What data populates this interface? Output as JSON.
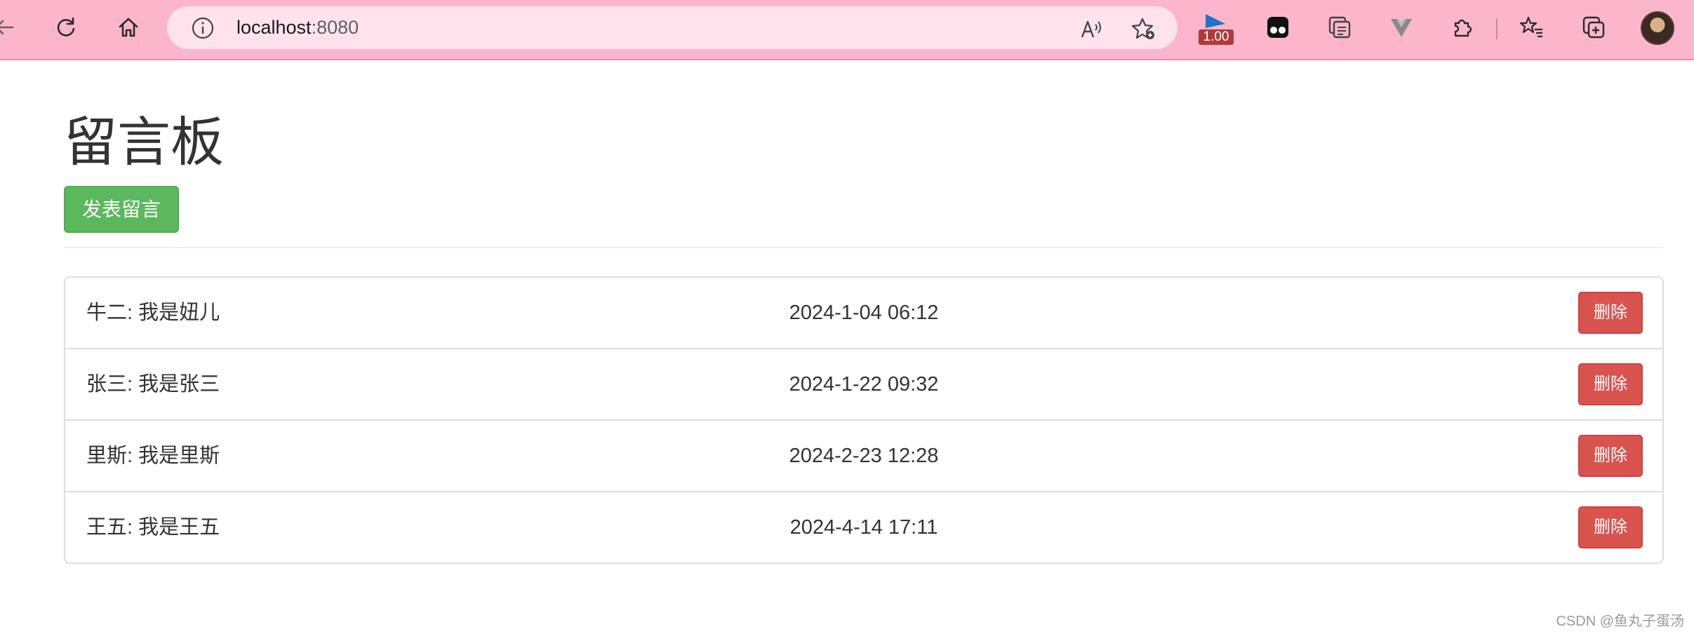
{
  "browser": {
    "url_host": "localhost",
    "url_port": ":8080",
    "speed_badge": "1.00"
  },
  "page": {
    "title": "留言板",
    "post_button": "发表留言"
  },
  "messages": [
    {
      "name": "牛二",
      "text": "我是妞儿",
      "display": "牛二: 我是妞儿",
      "time": "2024-1-04 06:12",
      "delete_label": "删除"
    },
    {
      "name": "张三",
      "text": "我是张三",
      "display": "张三: 我是张三",
      "time": "2024-1-22 09:32",
      "delete_label": "删除"
    },
    {
      "name": "里斯",
      "text": "我是里斯",
      "display": "里斯: 我是里斯",
      "time": "2024-2-23 12:28",
      "delete_label": "删除"
    },
    {
      "name": "王五",
      "text": "我是王五",
      "display": "王五: 我是王五",
      "time": "2024-4-14 17:11",
      "delete_label": "删除"
    }
  ],
  "watermark": "CSDN @鱼丸子蛋汤",
  "colors": {
    "toolbar": "#fbb6cc",
    "success": "#5cb85c",
    "danger": "#d9534f"
  },
  "icons": [
    "back-icon",
    "refresh-icon",
    "home-icon",
    "info-icon",
    "read-aloud-icon",
    "add-favorite-icon",
    "speed-extension-icon",
    "tampermonkey-icon",
    "collections-icon",
    "vue-devtools-icon",
    "extensions-icon",
    "favorites-icon",
    "browser-essentials-icon",
    "profile-avatar"
  ]
}
